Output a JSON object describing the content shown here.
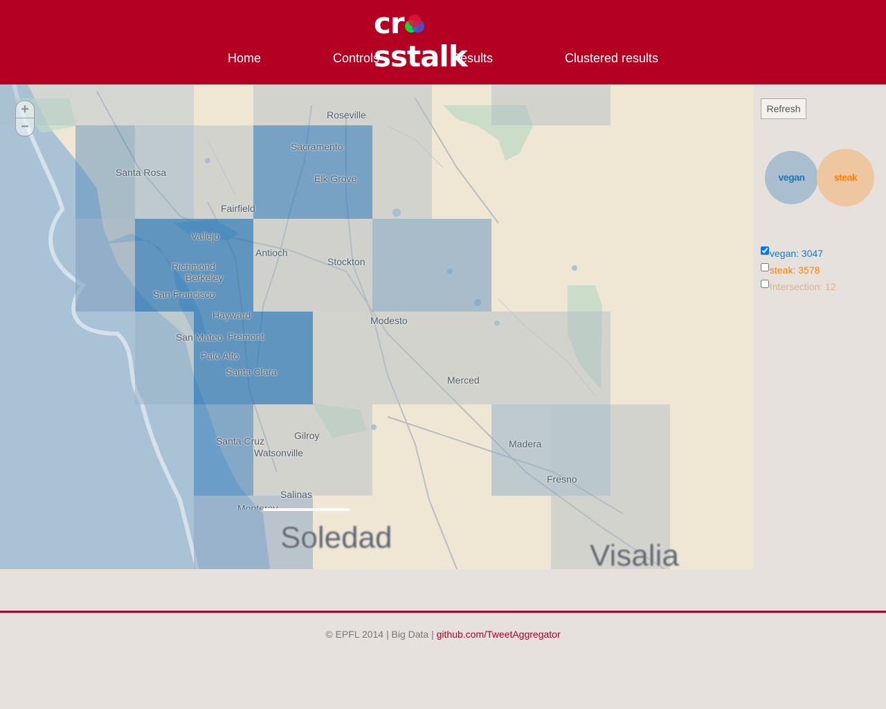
{
  "brand": {
    "logo_text": "crosstalk"
  },
  "nav": {
    "items": [
      {
        "label": "Home"
      },
      {
        "label": "Controls"
      },
      {
        "label": "Results"
      },
      {
        "label": "Clustered results"
      }
    ]
  },
  "map": {
    "zoom_in": "+",
    "zoom_out": "−",
    "cities": [
      "Roseville",
      "Sacramento",
      "Elk Grove",
      "Santa Rosa",
      "Fairfield",
      "Vallejo",
      "Antioch",
      "Stockton",
      "Richmond",
      "Berkeley",
      "San Francisco",
      "Hayward",
      "San Mateo",
      "Fremont",
      "Modesto",
      "Palo Alto",
      "Santa Clara",
      "Merced",
      "Santa Cruz",
      "Gilroy",
      "Watsonville",
      "Madera",
      "Fresno",
      "Salinas",
      "Monterey",
      "Soledad",
      "Visalia"
    ]
  },
  "sidebar": {
    "refresh_label": "Refresh",
    "bubbles": [
      {
        "label": "vegan",
        "color": "#1f77b4",
        "fill": "#a9bfcf"
      },
      {
        "label": "steak",
        "color": "#ff7f0e",
        "fill": "#eec69f"
      }
    ],
    "legend": [
      {
        "label": "vegan: 3047",
        "checked": true,
        "color": "#1f77b4"
      },
      {
        "label": "steak: 3578",
        "checked": false,
        "color": "#ff7f0e"
      },
      {
        "label": "Intersection: 12",
        "checked": false,
        "color": "#d9b48f"
      }
    ]
  },
  "footer": {
    "text": "© EPFL 2014 | Big Data | ",
    "link": "github.com/TweetAggregator"
  },
  "colors": {
    "brand": "#b30023",
    "vegan": "#1f77b4",
    "steak": "#ff7f0e"
  }
}
